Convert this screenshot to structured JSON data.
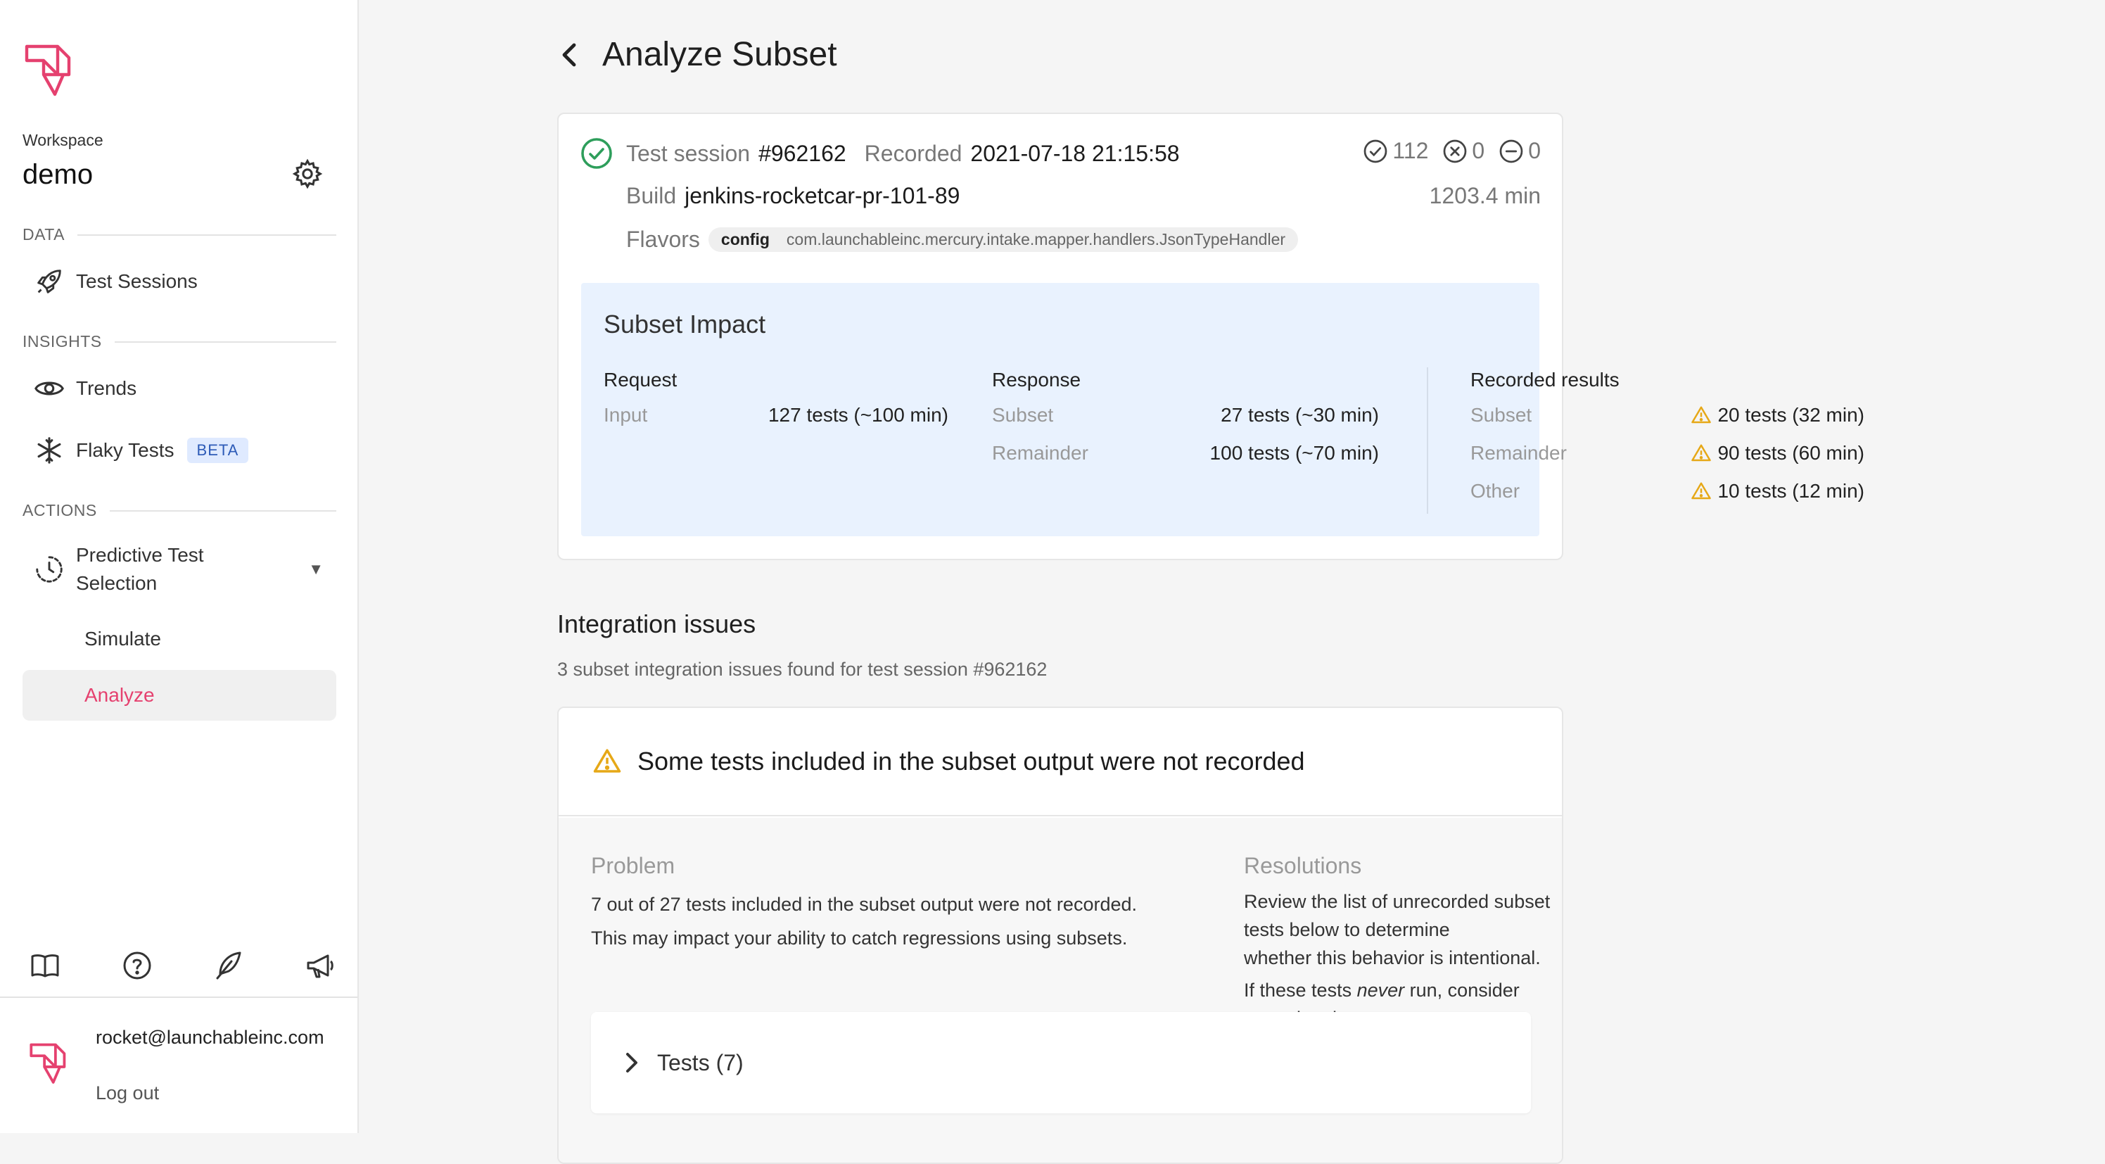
{
  "workspace": {
    "label": "Workspace",
    "name": "demo"
  },
  "sidebar": {
    "data_section": "DATA",
    "test_sessions": "Test Sessions",
    "insights_section": "INSIGHTS",
    "trends": "Trends",
    "flaky_tests": "Flaky Tests",
    "beta_badge": "BETA",
    "actions_section": "ACTIONS",
    "pts_line1": "Predictive Test",
    "pts_line2": "Selection",
    "simulate": "Simulate",
    "analyze": "Analyze"
  },
  "user": {
    "email": "rocket@launchableinc.com",
    "logout": "Log out"
  },
  "page": {
    "title": "Analyze Subset"
  },
  "session": {
    "label": "Test session",
    "id": "#962162",
    "recorded_label": "Recorded",
    "recorded_value": "2021-07-18 21:15:58",
    "build_label": "Build",
    "build_value": "jenkins-rocketcar-pr-101-89",
    "flavors_label": "Flavors",
    "flavor_key": "config",
    "flavor_value": "com.launchableinc.mercury.intake.mapper.handlers.JsonTypeHandler",
    "passed": "112",
    "failed": "0",
    "skipped": "0",
    "duration": "1203.4 min"
  },
  "impact": {
    "title": "Subset Impact",
    "request": {
      "head": "Request",
      "input_label": "Input",
      "input_value": "127 tests (~100 min)"
    },
    "response": {
      "head": "Response",
      "subset_label": "Subset",
      "subset_value": "27 tests (~30 min)",
      "remainder_label": "Remainder",
      "remainder_value": "100 tests (~70 min)"
    },
    "recorded": {
      "head": "Recorded results",
      "subset_label": "Subset",
      "subset_value": "20 tests (32 min)",
      "remainder_label": "Remainder",
      "remainder_value": "90 tests (60 min)",
      "other_label": "Other",
      "other_value": "10 tests (12 min)"
    }
  },
  "issues": {
    "title": "Integration issues",
    "subtitle": "3 subset integration issues found for test session #962162",
    "issue1": {
      "title": "Some tests included in the subset output were not recorded",
      "problem_head": "Problem",
      "problem_line1": "7 out of 27 tests included in the subset output were not recorded.",
      "problem_line2": "This may impact your ability to catch regressions using subsets.",
      "resolution_head": "Resolutions",
      "resolution_line1": "Review the list of unrecorded subset tests below to determine",
      "resolution_line2": "whether this behavior is intentional.",
      "resolution_line3_pre": "If these tests",
      "resolution_line3_em": "never",
      "resolution_line3_post": "run, consider removing them.",
      "tests_toggle": "Tests (7)"
    }
  },
  "colors": {
    "brand": "#e5416f",
    "success": "#2e9e5b",
    "warning": "#e6a817",
    "impact_bg": "#e9f2fe"
  }
}
